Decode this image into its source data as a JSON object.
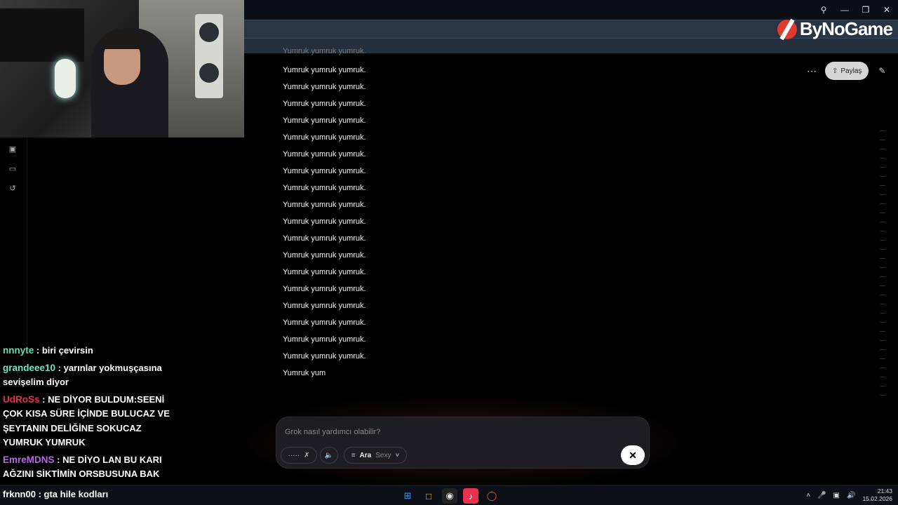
{
  "brand": {
    "name": "ByNoGame"
  },
  "conversation": {
    "partial_top": "Yumruk yumruk yumruk.",
    "lines": [
      "Yumruk yumruk yumruk.",
      "Yumruk yumruk yumruk.",
      "Yumruk yumruk yumruk.",
      "Yumruk yumruk yumruk.",
      "Yumruk yumruk yumruk.",
      "Yumruk yumruk yumruk.",
      "Yumruk yumruk yumruk.",
      "Yumruk yumruk yumruk.",
      "Yumruk yumruk yumruk.",
      "Yumruk yumruk yumruk.",
      "Yumruk yumruk yumruk.",
      "Yumruk yumruk yumruk.",
      "Yumruk yumruk yumruk.",
      "Yumruk yumruk yumruk.",
      "Yumruk yumruk yumruk.",
      "Yumruk yumruk yumruk.",
      "Yumruk yumruk yumruk.",
      "Yumruk yumruk yumruk.",
      "Yumruk yum"
    ]
  },
  "toolbar": {
    "share_label": "Paylaş"
  },
  "composer": {
    "placeholder": "Grok nasıl yardımcı olabilir?",
    "mode_label": "Ara",
    "voice_label": "Sexy"
  },
  "chat": {
    "messages": [
      {
        "user": "nnnyte",
        "user_color": "#5fe0b0",
        "text": " : biri çevirsin"
      },
      {
        "user": "grandeee10",
        "user_color": "#6fe6c0",
        "text": " : yarınlar yokmuşçasına sevişelim diyor"
      },
      {
        "user": "UdRoSs",
        "user_color": "#e8304a",
        "text": " : NE DİYOR BULDUM:SEENİ ÇOK KISA SÜRE İÇİNDE BULUCAZ VE ŞEYTANIN DELİĞİNE SOKUCAZ YUMRUK YUMRUK"
      },
      {
        "user": "EmreMDNS",
        "user_color": "#b866e8",
        "text": " : NE DİYO LAN BU KARI AĞZINI SİKTİMİN ORSBUSUNA BAK"
      }
    ],
    "last": {
      "user": "frknn00",
      "user_color": "#ffffff",
      "text": " : gta hile kodları"
    }
  },
  "taskbar": {
    "time": "21:43",
    "date": "15.02.2026"
  }
}
